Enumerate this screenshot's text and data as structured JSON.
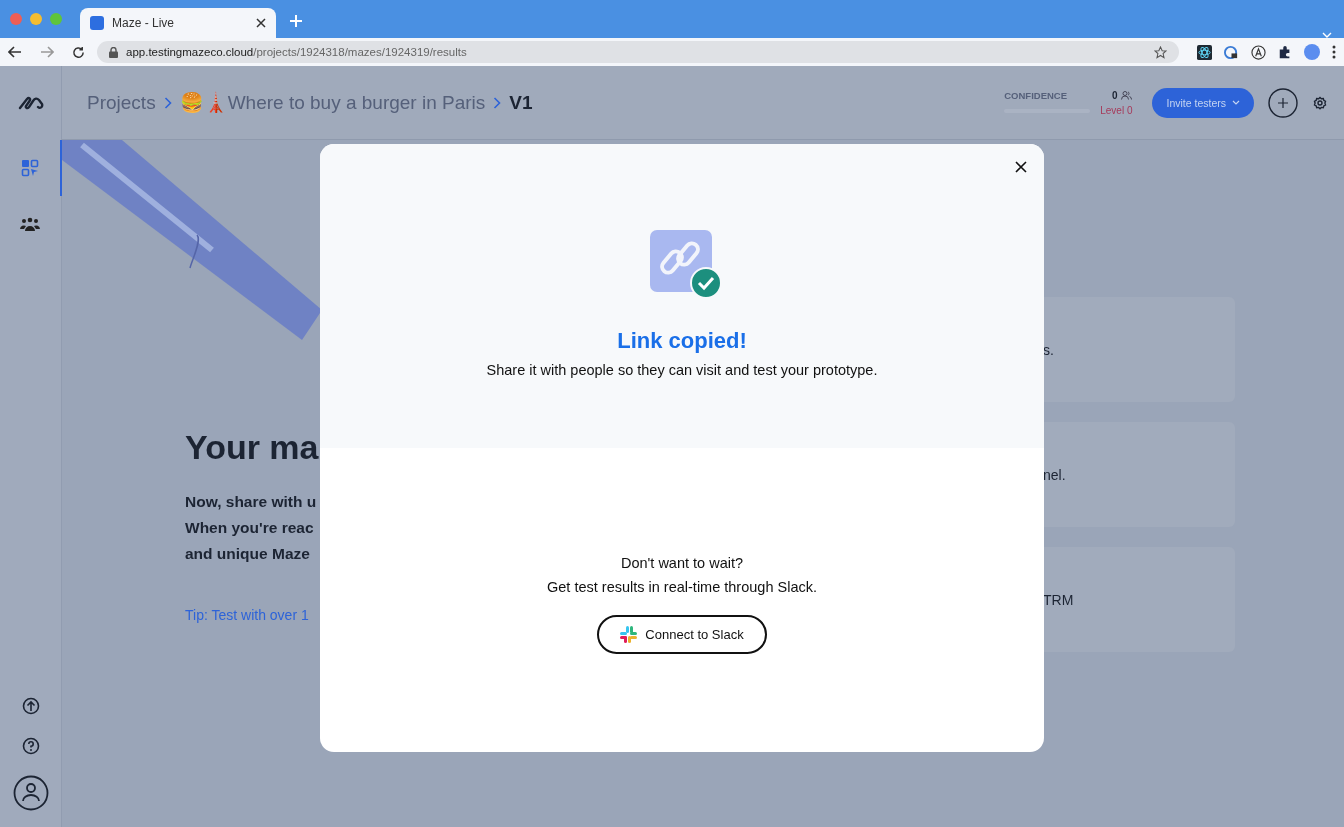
{
  "browser": {
    "tab": {
      "title": "Maze - Live",
      "selected": true
    },
    "url_host": "app.testingmazeco.cloud",
    "url_path": "/projects/1924318/mazes/1924319/results"
  },
  "sidebar": {
    "items": [
      {
        "kind": "dashboard",
        "selected": true
      },
      {
        "kind": "people",
        "selected": false
      }
    ],
    "bottom": [
      {
        "kind": "upgrade"
      },
      {
        "kind": "help"
      },
      {
        "kind": "account"
      }
    ]
  },
  "header": {
    "breadcrumb": [
      "Projects",
      "🍔🗼Where to buy a burger in Paris",
      "V1"
    ],
    "confidence": {
      "label": "CONFIDENCE",
      "count": "0",
      "level_text": "Level 0"
    },
    "invite_button": "Invite testers"
  },
  "background": {
    "heading": "Your ma",
    "paragraph": [
      "Now, share with u",
      "When you're reac",
      "and unique Maze"
    ],
    "tip": "Tip: Test with over 1",
    "cards": [
      "s.",
      "nel.",
      "TRM"
    ]
  },
  "modal": {
    "title": "Link copied!",
    "subtitle": "Share it with people so they can visit and test your prototype.",
    "prompt": [
      "Don't want to wait?",
      "Get test results in real-time through Slack."
    ],
    "button": "Connect to Slack"
  }
}
